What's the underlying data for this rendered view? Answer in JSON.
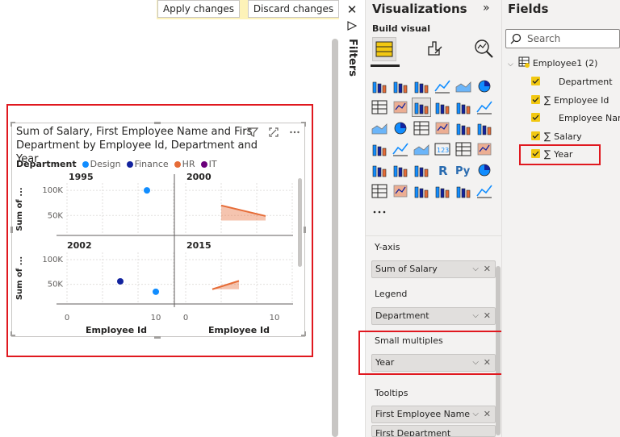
{
  "toolbar": {
    "apply_label": "Apply changes",
    "discard_label": "Discard changes"
  },
  "filters": {
    "label": "Filters"
  },
  "visual": {
    "title_line1": "Sum of Salary, First Employee Name and Firs",
    "title_line2": "Department by Employee Id, Department and Year",
    "legend_title": "Department",
    "legend": [
      {
        "name": "Design",
        "color": "#118dff"
      },
      {
        "name": "Finance",
        "color": "#12239e"
      },
      {
        "name": "HR",
        "color": "#e66c37"
      },
      {
        "name": "IT",
        "color": "#6b007b"
      }
    ]
  },
  "chart_data": {
    "type": "scatter",
    "panels": [
      {
        "title": "1995",
        "series": [
          {
            "name": "Design",
            "x": [
              9
            ],
            "y": [
              100000
            ]
          }
        ]
      },
      {
        "title": "2000",
        "series": [
          {
            "name": "HR",
            "type": "area",
            "x": [
              4,
              9
            ],
            "y": [
              70000,
              49000
            ]
          }
        ]
      },
      {
        "title": "2002",
        "series": [
          {
            "name": "Finance",
            "x": [
              6
            ],
            "y": [
              56000
            ]
          },
          {
            "name": "Design",
            "x": [
              10
            ],
            "y": [
              35000
            ]
          }
        ]
      },
      {
        "title": "2015",
        "series": [
          {
            "name": "HR",
            "type": "area",
            "x": [
              3,
              6
            ],
            "y": [
              40000,
              57000
            ]
          }
        ]
      }
    ],
    "xlabel": "Employee Id",
    "ylabel": "Sum of ...",
    "yticks": [
      "100K",
      "50K"
    ],
    "xticks": [
      "0",
      "10"
    ],
    "xlim": [
      0,
      12
    ],
    "ylim": [
      20000,
      105000
    ]
  },
  "viz_pane": {
    "title": "Visualizations",
    "build_visual": "Build visual",
    "more_label": "...",
    "wells": [
      {
        "label": "Y-axis",
        "value": "Sum of Salary"
      },
      {
        "label": "Legend",
        "value": "Department"
      },
      {
        "label": "Small multiples",
        "value": "Year"
      },
      {
        "label": "Tooltips",
        "value": "First Employee Name"
      }
    ],
    "tooltips_second": "First Department"
  },
  "fields_pane": {
    "title": "Fields",
    "search_placeholder": "Search",
    "table_name": "Employee1 (2)",
    "fields": [
      {
        "name": "Department",
        "sigma": false
      },
      {
        "name": "Employee Id",
        "sigma": true
      },
      {
        "name": "Employee Nam",
        "sigma": false
      },
      {
        "name": "Salary",
        "sigma": true
      },
      {
        "name": "Year",
        "sigma": true
      }
    ]
  },
  "colors": {
    "accent_yellow": "#f2c811",
    "highlight_red": "#e0181f",
    "pane_bg": "#f3f2f1"
  }
}
